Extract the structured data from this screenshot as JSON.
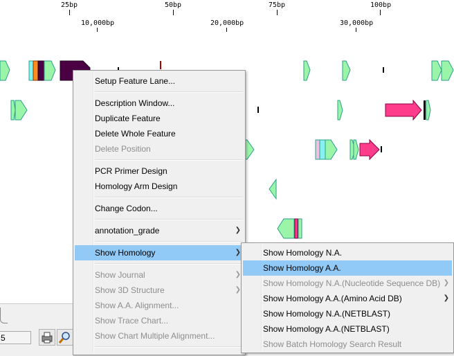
{
  "ruler": {
    "top_labels": [
      "25bp",
      "50bp",
      "75bp",
      "100bp"
    ],
    "bottom_labels": [
      "10,000bp",
      "20,000bp",
      "30,000bp"
    ]
  },
  "status": {
    "field_value": "5"
  },
  "colors": {
    "feature_green": "#9bf5a8",
    "feature_pink": "#ff3c8c",
    "feature_dark": "#4a0042",
    "feature_cyan": "#88f0f0",
    "menu_bg": "#f0f0f0",
    "menu_highlight": "#91c9f7"
  },
  "context_menu": {
    "items": [
      {
        "label": "Setup Feature Lane...",
        "enabled": true
      },
      {
        "label": "Description Window...",
        "enabled": true
      },
      {
        "label": "Duplicate Feature",
        "enabled": true
      },
      {
        "label": "Delete Whole Feature",
        "enabled": true
      },
      {
        "label": "Delete Position",
        "enabled": false
      },
      {
        "label": "PCR Primer Design",
        "enabled": true
      },
      {
        "label": "Homology Arm Design",
        "enabled": true
      },
      {
        "label": "Change Codon...",
        "enabled": true
      },
      {
        "label": "annotation_grade",
        "enabled": true,
        "submenu": true
      },
      {
        "label": "Show Homology",
        "enabled": true,
        "submenu": true,
        "highlighted": true
      },
      {
        "label": "Show Journal",
        "enabled": false,
        "submenu": true
      },
      {
        "label": "Show 3D Structure",
        "enabled": false,
        "submenu": true
      },
      {
        "label": "Show A.A. Alignment...",
        "enabled": false
      },
      {
        "label": "Show Trace Chart...",
        "enabled": false
      },
      {
        "label": "Show Chart Multiple Alignment...",
        "enabled": false
      }
    ]
  },
  "submenu": {
    "items": [
      {
        "label": "Show Homology N.A.",
        "enabled": true
      },
      {
        "label": "Show Homology A.A.",
        "enabled": true,
        "highlighted": true
      },
      {
        "label": "Show Homology N.A.(Nucleotide Sequence DB)",
        "enabled": false,
        "submenu": true
      },
      {
        "label": "Show Homology A.A.(Amino Acid DB)",
        "enabled": true,
        "submenu": true
      },
      {
        "label": "Show Homology N.A.(NETBLAST)",
        "enabled": true
      },
      {
        "label": "Show Homology A.A.(NETBLAST)",
        "enabled": true
      },
      {
        "label": "Show Batch Homology Search Result",
        "enabled": false
      }
    ]
  }
}
